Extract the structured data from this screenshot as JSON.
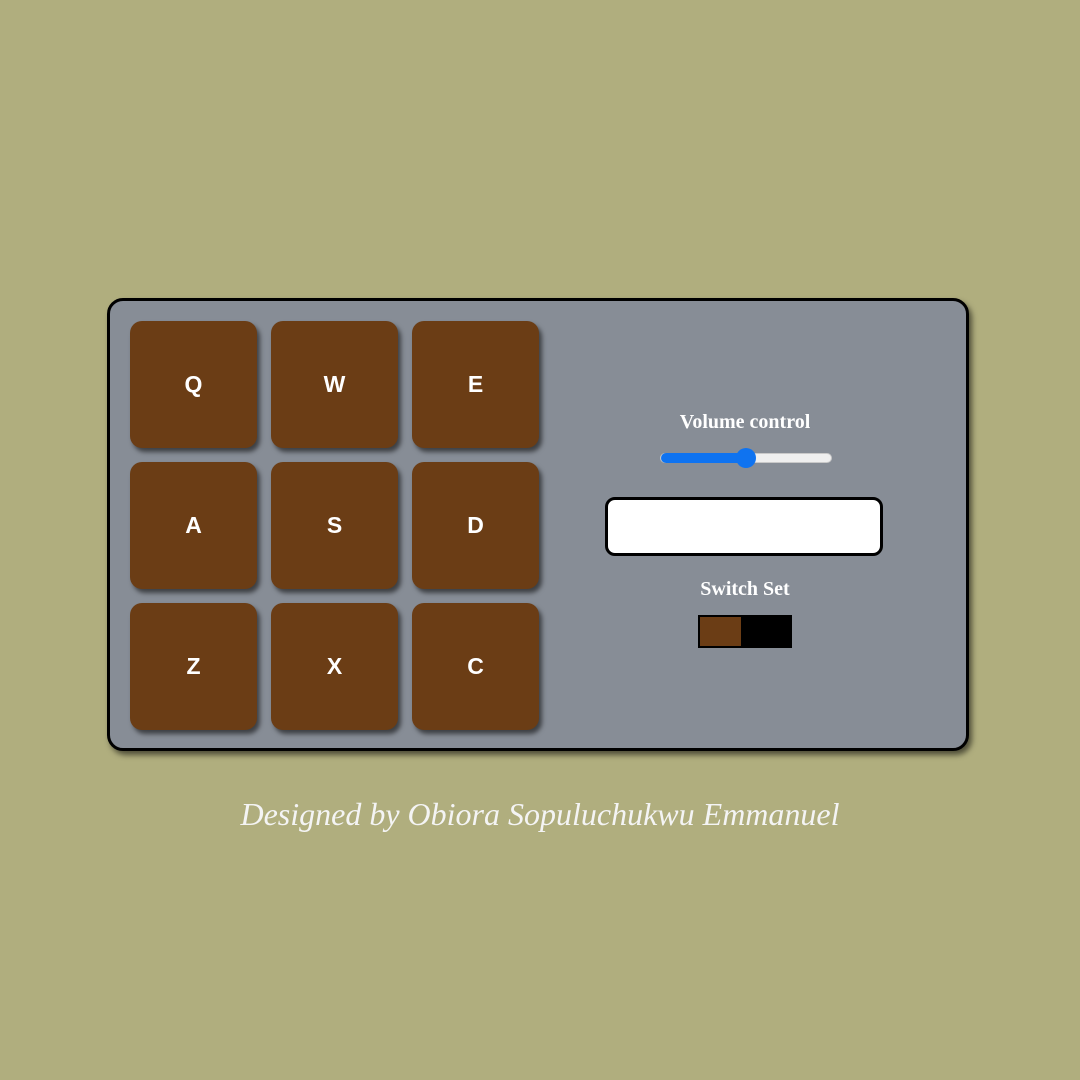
{
  "pads": [
    {
      "key": "Q"
    },
    {
      "key": "W"
    },
    {
      "key": "E"
    },
    {
      "key": "A"
    },
    {
      "key": "S"
    },
    {
      "key": "D"
    },
    {
      "key": "Z"
    },
    {
      "key": "X"
    },
    {
      "key": "C"
    }
  ],
  "controls": {
    "volume_label": "Volume control",
    "volume_level": 0.5,
    "display_text": "",
    "switch_label": "Switch Set",
    "switch_on": false
  },
  "credit": "Designed by Obiora Sopuluchukwu Emmanuel",
  "colors": {
    "background": "#b0ae7e",
    "panel": "#878d96",
    "pad": "#6b3d15",
    "accent": "#0f73f0"
  }
}
